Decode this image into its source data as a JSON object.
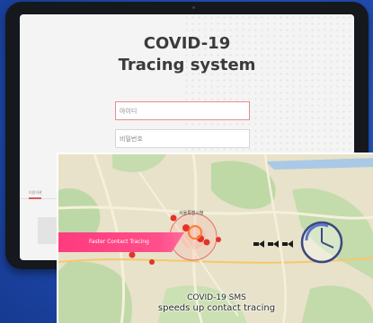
{
  "app": {
    "title_line1": "COVID-19",
    "title_line2": "Tracing system",
    "id_placeholder": "아이디",
    "password_placeholder": "비밀번호",
    "footer_link": "이용약관"
  },
  "map": {
    "city_hall_label": "서울특별시청",
    "banner_text": "Faster Contact Tracing",
    "caption_line1": "COVID-19 SMS",
    "caption_line2": "speeds up contact tracing"
  },
  "colors": {
    "background": "#1f4bb0",
    "banner": "#ff3b7d",
    "marker": "#e0352b",
    "clock": "#3d4880"
  }
}
